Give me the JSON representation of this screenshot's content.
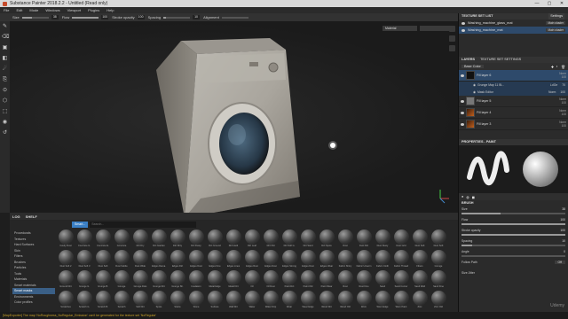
{
  "window": {
    "title": "Substance Painter 2018.2.2 - Untitled (Read only)",
    "controls": [
      "—",
      "▢",
      "✕"
    ]
  },
  "menu": [
    "File",
    "Edit",
    "Mode",
    "Windows",
    "Viewport",
    "Plugins",
    "Help"
  ],
  "toolbar": {
    "size": {
      "label": "Size",
      "value": "38"
    },
    "flow": {
      "label": "Flow",
      "value": "100"
    },
    "stroke_opacity": {
      "label": "Stroke opacity",
      "value": "100"
    },
    "spacing": {
      "label": "Spacing",
      "value": "10"
    },
    "extra": {
      "label": "Alignment"
    }
  },
  "viewport": {
    "display_dropdown": "Material",
    "extra_dropdown": ""
  },
  "texture_set_list": {
    "header": "TEXTURE SET LIST",
    "settings": "Settings",
    "items": [
      {
        "name": "Washing_machine_glass_mat",
        "shader": "Main shader"
      },
      {
        "name": "Washing_machine_mat",
        "shader": "Main shader"
      }
    ]
  },
  "layers": {
    "tabs": [
      "LAYERS",
      "TEXTURE SET SETTINGS"
    ],
    "channel": "Base Color",
    "items": [
      {
        "name": "Fill layer 6",
        "mode": "Norm",
        "opacity": "100",
        "thumb": "dark"
      },
      {
        "name": "Fill layer 5",
        "mode": "Norm",
        "opacity": "100",
        "thumb": "gray"
      },
      {
        "name": "Fill layer 4",
        "mode": "Norm",
        "opacity": "100",
        "thumb": "orange"
      },
      {
        "name": "Fill layer 3",
        "mode": "Norm",
        "opacity": "100",
        "thumb": "orange"
      }
    ],
    "sub": [
      {
        "name": "Grunge Map 11 Bl...",
        "mode": "LdGe",
        "value": "70"
      },
      {
        "name": "Mask Editor",
        "mode": "Norm",
        "value": "100"
      }
    ]
  },
  "properties": {
    "header": "PROPERTIES - PAINT",
    "section": "BRUSH",
    "sliders": [
      {
        "label": "Size",
        "value": "38",
        "fill": 0.38
      },
      {
        "label": "Flow",
        "value": "100",
        "fill": 1.0
      },
      {
        "label": "Stroke opacity",
        "value": "100",
        "fill": 1.0
      },
      {
        "label": "Spacing",
        "value": "10",
        "fill": 0.1
      },
      {
        "label": "Angle",
        "value": "0",
        "fill": 0.0
      }
    ],
    "follow_path": {
      "label": "Follow Path",
      "value": "Off"
    },
    "size_jitter": {
      "label": "Size Jitter"
    }
  },
  "shelf": {
    "tabs": [
      "LOG",
      "SHELF"
    ],
    "filter_chip": "Smart...",
    "search_placeholder": "Search...",
    "categories": [
      "Procedurals",
      "Textures",
      "Hard Surfaces",
      "Skin",
      "Filters",
      "Brushes",
      "Particles",
      "Tools",
      "Materials",
      "Smart materials",
      "Smart masks",
      "Environments",
      "Color profiles"
    ],
    "selected_category": "Smart masks",
    "items": [
      "Cavity Rust",
      "Concrete G.",
      "Concrete E.",
      "Concrete",
      "Dirt Dry",
      "Dirt Garden",
      "Dirt Dirty",
      "Dirt Dusty",
      "Dirt Ground",
      "Dirt Hard",
      "Dirt Leaf",
      "Dirt Old",
      "Dirt Soft G.",
      "Dirt Sand",
      "Dirt Spots",
      "Dust",
      "Dust Dirt",
      "Dust Dusty",
      "Dust Grid",
      "Dust Soft",
      "Dust Soft",
      "Dust Soft 2",
      "Dust Soft 3",
      "Dust Soft",
      "Dust Subtle",
      "Dust Wide",
      "Edges Dama.",
      "Edges Dirt",
      "Edges Dust",
      "Edges Fine",
      "Edges Lines",
      "Edges Rust",
      "Edges Dust",
      "Edges Strong",
      "Edges Dust",
      "Edges Wear",
      "Fabric Shiny",
      "Fabric Unworn",
      "Fabric Cloth",
      "Fabric Thread",
      "Fibers",
      "Grunge",
      "Ground Dirt",
      "Grunge G.",
      "Grunge B.",
      "Grunge",
      "Grunge Dots",
      "Grunge Dirt",
      "Grunge Sh.",
      "Insulation",
      "Metal Edge",
      "Metal Dirt",
      "Oil",
      "Oil Dust",
      "Paint Dirt",
      "Paint Old",
      "Paint Wear",
      "Rust",
      "Rust Fine",
      "Sand",
      "Sand Corner",
      "Sand Wall",
      "Sand Fine",
      "Scratches",
      "Scratch G.",
      "Scratch B.",
      "Scratch",
      "Soft Dirt",
      "Spots",
      "Stains",
      "Stone",
      "Surface",
      "Wall Dirt",
      "Water",
      "Water Drip",
      "Wear",
      "Wear Edge",
      "Wood Dirt",
      "Wood Old",
      "Worn",
      "Worn Edge",
      "Worn Paint",
      "Zinc",
      "Zinc Old"
    ]
  },
  "statusbar": {
    "message": "[MapExporter] The map 'NoRoughness_NoRegular_Emission' can't be generated for the texture set 'NoRegular'"
  },
  "watermark": "Udemy"
}
